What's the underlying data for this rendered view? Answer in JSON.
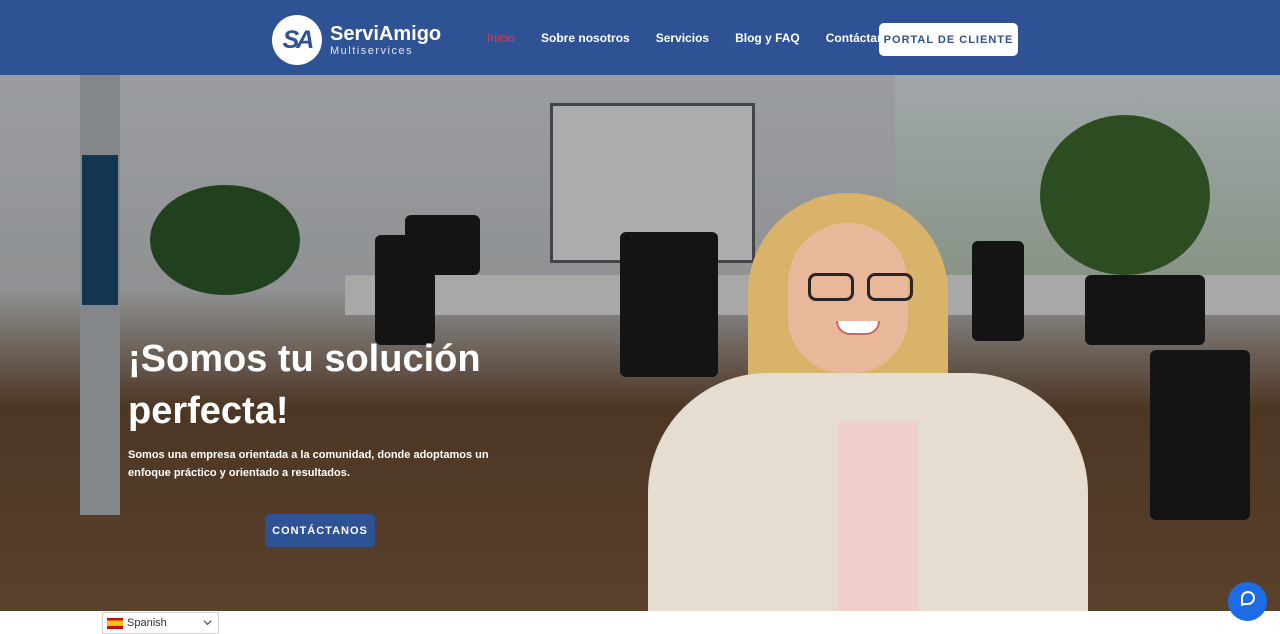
{
  "header": {
    "brand_name": "ServiAmigo",
    "brand_sub": "Multiservices",
    "logo_mark": "SA",
    "nav": [
      {
        "label": "Inicio",
        "active": true
      },
      {
        "label": "Sobre nosotros",
        "active": false
      },
      {
        "label": "Servicios",
        "active": false
      },
      {
        "label": "Blog y FAQ",
        "active": false
      },
      {
        "label": "Contáctanos",
        "active": false
      }
    ],
    "portal_button": "PORTAL DE CLIENTE"
  },
  "hero": {
    "title": "¡Somos tu solución perfecta!",
    "description": "Somos una empresa orientada a la comunidad, donde adoptamos un enfoque práctico y orientado a resultados.",
    "cta_label": "CONTÁCTANOS"
  },
  "language_selector": {
    "selected": "Spanish"
  },
  "chat": {
    "icon": "chat-icon"
  },
  "colors": {
    "primary": "#2e5294",
    "nav_active": "#e23a45",
    "chat": "#1d6be6"
  }
}
